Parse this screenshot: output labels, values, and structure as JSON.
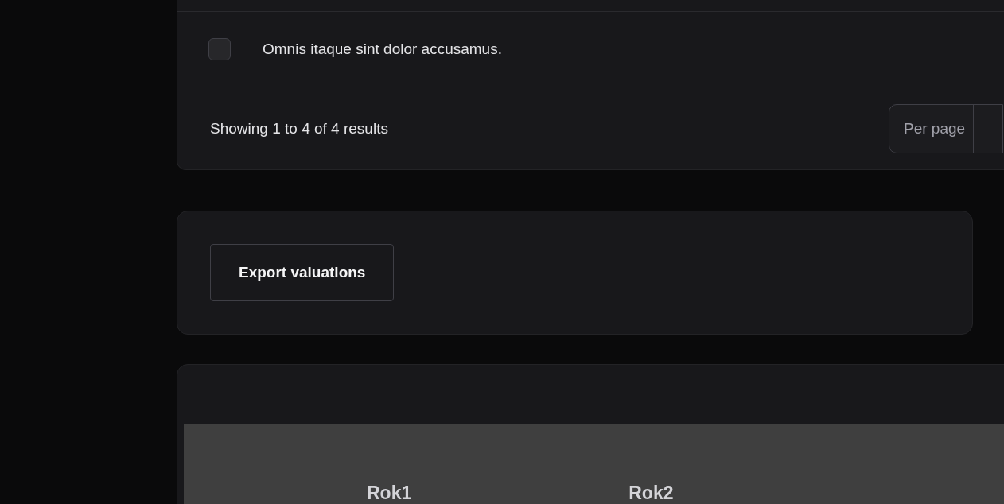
{
  "table": {
    "rows": [
      {
        "checked": false,
        "text": "Omnis itaque sint dolor accusamus."
      }
    ],
    "summary": "Showing 1 to 4 of 4 results",
    "per_page": {
      "label": "Per page"
    }
  },
  "actions": {
    "buttons": [
      "Export valuations"
    ]
  },
  "valuations_table": {
    "columns": [
      "Rok1",
      "Rok2"
    ]
  }
}
